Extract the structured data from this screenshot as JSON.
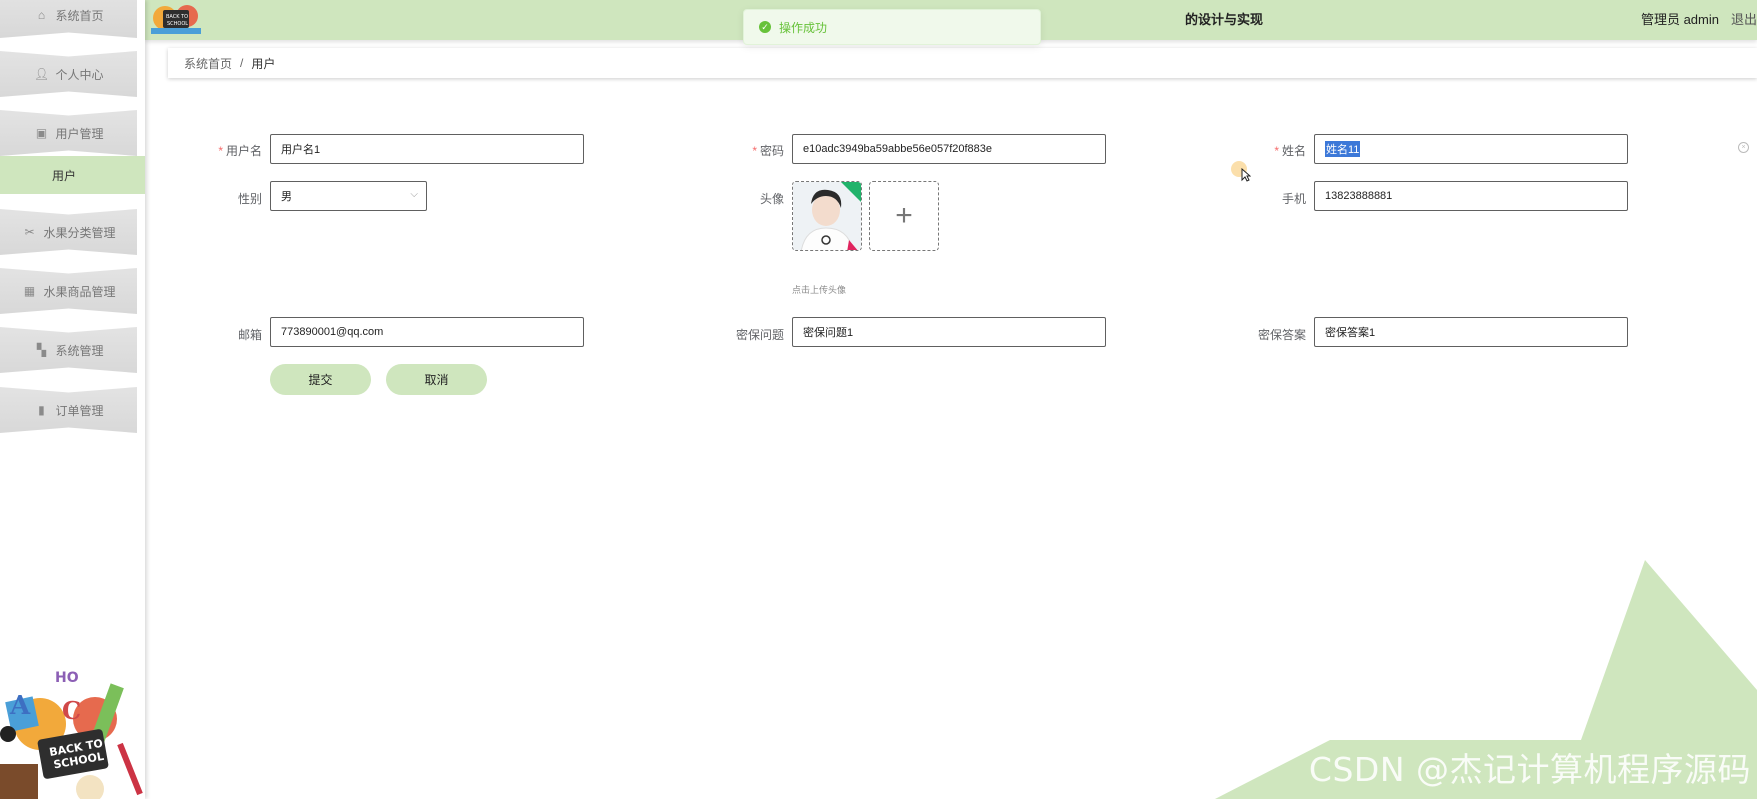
{
  "header": {
    "title": "的设计与实现",
    "user": "管理员 admin",
    "logout": "退出"
  },
  "toast": {
    "text": "操作成功"
  },
  "sidebar": {
    "items": [
      {
        "label": "系统首页",
        "icon": "home-icon"
      },
      {
        "label": "个人中心",
        "icon": "user-icon"
      },
      {
        "label": "用户管理",
        "icon": "clipboard-icon"
      },
      {
        "label": "水果分类管理",
        "icon": "ticket-icon"
      },
      {
        "label": "水果商品管理",
        "icon": "grid-icon"
      },
      {
        "label": "系统管理",
        "icon": "apps-icon"
      },
      {
        "label": "订单管理",
        "icon": "bar-chart-icon"
      }
    ],
    "submenu": {
      "label": "用户"
    }
  },
  "breadcrumb": {
    "home": "系统首页",
    "separator": "/",
    "current": "用户"
  },
  "form": {
    "username": {
      "label": "用户名",
      "value": "用户名1"
    },
    "password": {
      "label": "密码",
      "value": "e10adc3949ba59abbe56e057f20f883e"
    },
    "name": {
      "label": "姓名",
      "value": "姓名11"
    },
    "gender": {
      "label": "性别",
      "value": "男"
    },
    "avatar": {
      "label": "头像",
      "tip": "点击上传头像"
    },
    "phone": {
      "label": "手机",
      "value": "13823888881"
    },
    "email": {
      "label": "邮箱",
      "value": "773890001@qq.com"
    },
    "question": {
      "label": "密保问题",
      "value": "密保问题1"
    },
    "answer": {
      "label": "密保答案",
      "value": "密保答案1"
    },
    "submit": "提交",
    "cancel": "取消"
  },
  "watermark": "CSDN @杰记计算机程序源码",
  "colors": {
    "accent": "#cfe6be",
    "success": "#67c23a",
    "required": "#f56c6c"
  }
}
